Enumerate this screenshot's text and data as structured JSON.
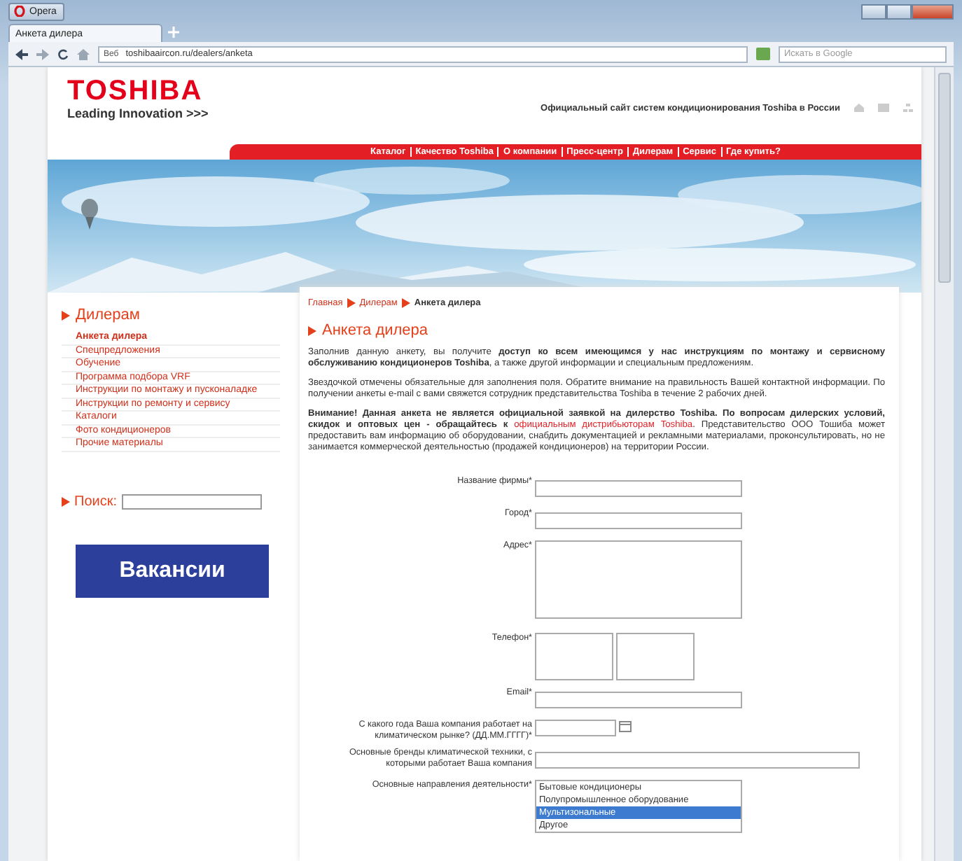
{
  "browser": {
    "menu_button": "Opera",
    "tabs": [
      {
        "label": "Анкета дилера",
        "selected": true
      }
    ],
    "security_badge": "Веб",
    "address": "toshibaaircon.ru/dealers/anketa",
    "search": {
      "placeholder": "Искать в Google"
    }
  },
  "header": {
    "logo": "TOSHIBA",
    "tagline": "Leading Innovation >>>",
    "site_title": "Официальный сайт систем кондиционирования Toshiba в России",
    "nav": [
      "Каталог",
      "Качество Toshiba",
      "О компании",
      "Пресс-центр",
      "Дилерам",
      "Сервис",
      "Где купить?"
    ]
  },
  "sidebar": {
    "section_title": "Дилерам",
    "items": [
      {
        "label": "Анкета дилера",
        "selected": true
      },
      {
        "label": "Спецпредложения",
        "selected": false
      },
      {
        "label": "Обучение",
        "selected": false
      },
      {
        "label": "Программа подбора VRF",
        "selected": false
      },
      {
        "label": "Инструкции по монтажу и пусконаладке",
        "selected": false
      },
      {
        "label": "Инструкции по ремонту и сервису",
        "selected": false
      },
      {
        "label": "Каталоги",
        "selected": false
      },
      {
        "label": "Фото кондиционеров",
        "selected": false
      },
      {
        "label": "Прочие материалы",
        "selected": false
      }
    ],
    "search_label": "Поиск:",
    "vacancies_button": "Вакансии"
  },
  "content": {
    "breadcrumb": [
      "Главная",
      "Дилерам",
      "Анкета дилера"
    ],
    "heading": "Анкета дилера",
    "paragraphs": [
      "Заполнив данную анкету, вы получите **доступ ко всем имеющимся у нас инструкциям по монтажу и сервисному обслуживанию кондиционеров Toshiba**, а также другой информации и специальным предложениям.",
      "Звездочкой отмечены обязательные для заполнения поля. Обратите внимание на правильность Вашей контактной информации. По получении анкеты e-mail с вами свяжется сотрудник представительства Toshiba в течение 2 рабочих дней."
    ],
    "notice": {
      "before": "Внимание! Данная анкета не является официальной заявкой на дилерство Toshiba. По вопросам дилерских условий, скидок и оптовых цен - обращайтесь к",
      "link": "официальным дистрибьюторам Toshiba",
      "after": ". Представительство ООО Тошиба может предоставить вам информацию об оборудовании, снабдить документацией и рекламными материалами, проконсультировать, но не занимается коммерческой деятельностью (продажей кондиционеров) на территории России."
    }
  },
  "form": {
    "fields": [
      {
        "kind": "text",
        "label": "Название фирмы*"
      },
      {
        "kind": "text",
        "label": "Город*"
      },
      {
        "kind": "textarea",
        "label": "Адрес*"
      },
      {
        "kind": "phone",
        "label": "Телефон*"
      },
      {
        "kind": "text",
        "label": "Email*"
      },
      {
        "kind": "date",
        "label": "С какого года Ваша компания работает на климатическом рынке? (ДД.ММ.ГГГГ)*"
      },
      {
        "kind": "wide",
        "label": "Основные бренды климатической техники, с которыми работает Ваша компания"
      },
      {
        "kind": "listbox",
        "label": "Основные направления деятельности*",
        "options": [
          {
            "label": "Бытовые кондиционеры",
            "selected": false
          },
          {
            "label": "Полупромышленное оборудование",
            "selected": false
          },
          {
            "label": "Мультизональные",
            "selected": true
          },
          {
            "label": "Другое",
            "selected": false
          }
        ]
      }
    ]
  }
}
